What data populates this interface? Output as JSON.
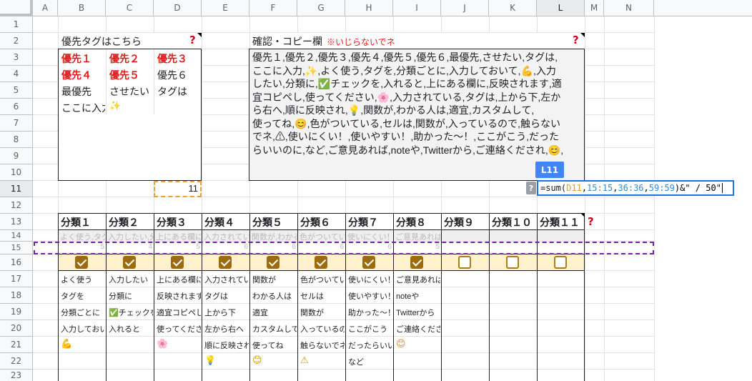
{
  "columns": [
    "A",
    "B",
    "C",
    "D",
    "E",
    "F",
    "G",
    "H",
    "I",
    "J",
    "K",
    "L",
    "M",
    "N"
  ],
  "rows": [
    "1",
    "2",
    "3",
    "4",
    "5",
    "6",
    "7",
    "8",
    "9",
    "10",
    "11",
    "12",
    "13",
    "14",
    "15",
    "16",
    "17",
    "18",
    "19",
    "20",
    "21",
    "22",
    "23"
  ],
  "left_panel": {
    "title": "優先タグはこちら",
    "help": "?",
    "r3": [
      "優先１",
      "優先２",
      "優先３"
    ],
    "r4": [
      "優先４",
      "優先５",
      "優先６"
    ],
    "r5": [
      "最優先",
      "させたい",
      "タグは"
    ],
    "r6": [
      "ここに入力",
      "✨"
    ],
    "d11_value": "11"
  },
  "right_panel": {
    "title": "確認・コピー欄",
    "warning": "※いじらないでネ",
    "help": "?",
    "lines": [
      "優先１,優先２,優先３,優先４,優先５,優先６,最優先,させたい,タグは,",
      "ここに入力,✨,よく使う,タグを,分類ごとに,入力しておいて,💪,入力",
      "したい,分類に,✅チェックを,入れると,上にある欄に,反映されます,適",
      "宜コピペし,使ってください,🌸,入力されている,タグは,上から下,左か",
      "ら右へ,順に反映され,💡,関数が,わかる人は,適宜,カスタムして,",
      "使ってね,😊,色がついている,セルは,関数が,入っているので,触らない",
      "でネ,⚠,使いにくい！,使いやすい！,助かった～！,ここがこう,だった",
      "らいいのに,など,ご意見あれば,noteや,Twitterから,ご連絡くだされ,😊,"
    ]
  },
  "cell_ref_tooltip": "L11",
  "formula_help": "?",
  "formula": {
    "prefix": "=sum(",
    "ref1": "D11",
    "sep1": ",",
    "ref2": "15:15",
    "sep2": ",",
    "ref3": "36:36",
    "sep3": ",",
    "ref4": "59:59",
    "suffix": ")&\" / 50\""
  },
  "categories": {
    "headers": [
      "分類１",
      "分類２",
      "分類３",
      "分類４",
      "分類５",
      "分類６",
      "分類７",
      "分類８",
      "分類９",
      "分類１０",
      "分類１１"
    ],
    "help": "?",
    "row14_previews": [
      "よく使う,タグ",
      "入力したい,分",
      "上にある欄に",
      "入力されてい",
      "関数が,わかる",
      "色がついてい",
      "使いにくい！",
      "ご意見あれば",
      "",
      "",
      ""
    ],
    "row15_counts": [
      "5",
      "4",
      "5",
      "6",
      "6",
      "6",
      "6",
      "5",
      "",
      "",
      ""
    ],
    "checked": [
      true,
      true,
      true,
      true,
      true,
      true,
      true,
      true,
      false,
      false,
      false
    ],
    "tags": [
      [
        "よく使う",
        "タグを",
        "分類ごとに",
        "入力しておい",
        "💪",
        ""
      ],
      [
        "入力したい",
        "分類に",
        "✅チェックを",
        "入れると",
        "",
        ""
      ],
      [
        "上にある欄に",
        "反映されます",
        "適宜コピペし",
        "使ってくださ",
        "🌸",
        ""
      ],
      [
        "入力されてい",
        "タグは",
        "上から下",
        "左から右へ",
        "順に反映され",
        "💡"
      ],
      [
        "関数が",
        "わかる人は",
        "適宜",
        "カスタムして",
        "使ってね",
        "😊"
      ],
      [
        "色がついてい",
        "セルは",
        "関数が",
        "入っているの",
        "触らないでネ",
        "⚠"
      ],
      [
        "使いにくい！",
        "使いやすい！",
        "助かった～！",
        "ここがこう",
        "だったらいい",
        "など"
      ],
      [
        "ご意見あれば",
        "noteや",
        "Twitterから",
        "ご連絡くださ",
        "😊",
        ""
      ],
      [
        "",
        "",
        "",
        "",
        "",
        ""
      ],
      [
        "",
        "",
        "",
        "",
        "",
        ""
      ],
      [
        "",
        "",
        "",
        "",
        "",
        ""
      ]
    ]
  },
  "colors": {
    "accent": "#1a73e8",
    "red": "#e01b1b",
    "checkbox": "#9c6b10",
    "row16_bg": "#fff2cc",
    "row15_dash": "#7b1fa2",
    "d11_dash": "#f0a030"
  }
}
